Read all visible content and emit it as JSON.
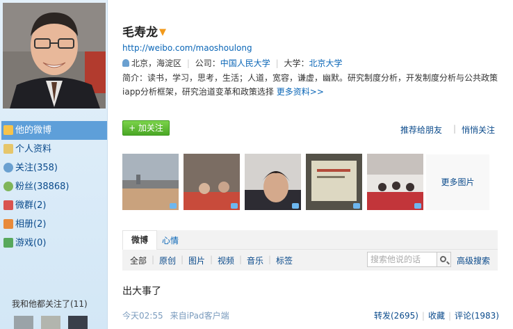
{
  "profile": {
    "name": "毛寿龙",
    "url": "http://weibo.com/maoshoulong",
    "location": "北京，海淀区",
    "company_label": "公司：",
    "company": "中国人民大学",
    "university_label": "大学：",
    "university": "北京大学",
    "bio": "简介：读书，学习，思考，生活；人道，宽容，谦虚，幽默。研究制度分析，开发制度分析与公共政策iapp分析框架，研究治道变革和政策选择",
    "more_info": "更多资料>>"
  },
  "actions": {
    "follow": "+ 加关注",
    "recommend": "推荐给朋友",
    "separator": "|",
    "quiet_follow": "悄悄关注"
  },
  "sidebar": {
    "items": [
      {
        "label": "他的微博",
        "icon": "home-icon"
      },
      {
        "label": "个人资料",
        "icon": "profile-icon"
      },
      {
        "label": "关注(358)",
        "icon": "follow-icon"
      },
      {
        "label": "粉丝(38868)",
        "icon": "fans-icon"
      },
      {
        "label": "微群(2)",
        "icon": "group-icon"
      },
      {
        "label": "相册(2)",
        "icon": "album-icon"
      },
      {
        "label": "游戏(0)",
        "icon": "game-icon"
      }
    ],
    "mutual": "我和他都关注了(11)"
  },
  "photos": {
    "more": "更多图片"
  },
  "tabs": {
    "weibo": "微博",
    "mood": "心情"
  },
  "filters": {
    "items": [
      "全部",
      "原创",
      "图片",
      "视频",
      "音乐",
      "标签"
    ],
    "search_placeholder": "搜索他说的话",
    "advanced": "高级搜索"
  },
  "post": {
    "text": "出大事了",
    "time": "今天02:55",
    "source": "来自iPad客户端",
    "repost": "转发(2695)",
    "favorite": "收藏",
    "comment": "评论(1983)"
  },
  "colors": {
    "link": "#0a66b7",
    "nav_active": "#5e9fd9",
    "follow_green": "#4aa726",
    "verified": "#f29a1b"
  }
}
